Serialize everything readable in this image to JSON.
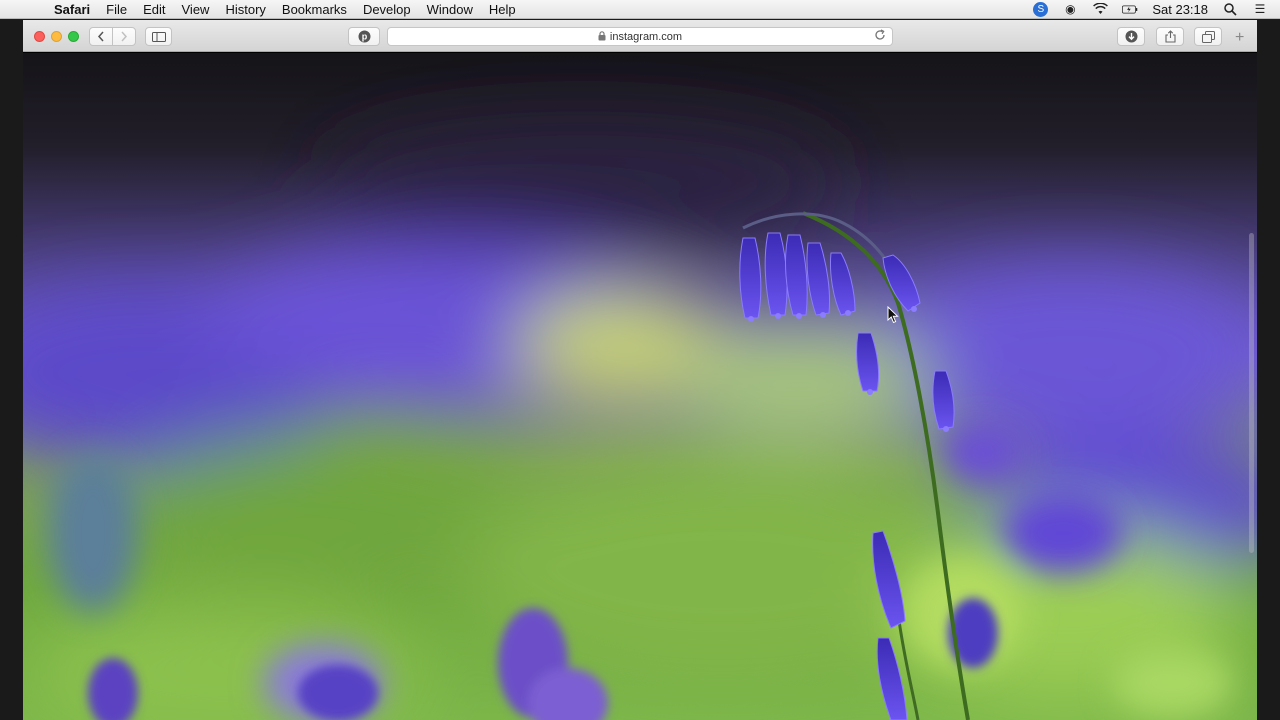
{
  "menubar": {
    "app_name": "Safari",
    "menus": [
      "File",
      "Edit",
      "View",
      "History",
      "Bookmarks",
      "Develop",
      "Window",
      "Help"
    ],
    "clock": "Sat 23:18",
    "icons": [
      "skype-icon",
      "record-icon",
      "wifi-icon",
      "battery-icon",
      "spotlight-icon",
      "notification-center-icon"
    ]
  },
  "toolbar": {
    "url": "instagram.com",
    "secure": true
  },
  "colors": {
    "accent_blue": "#2a6fd6",
    "flower_violet": "#5a3ed8",
    "stem_green": "#3d6b1f"
  }
}
